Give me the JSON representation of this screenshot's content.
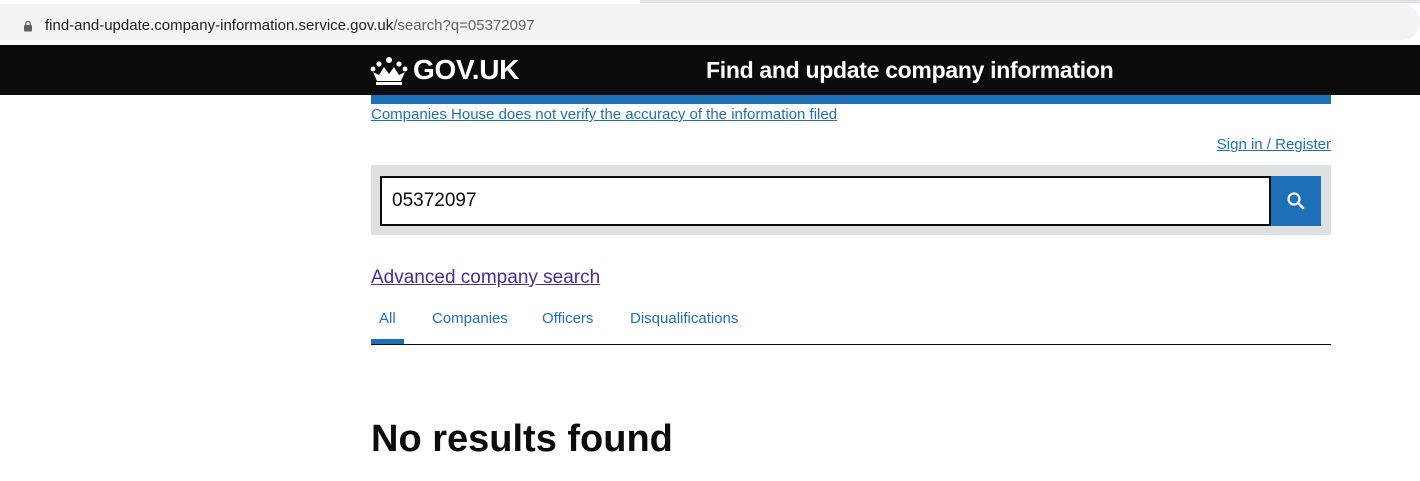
{
  "browser": {
    "url_host": "find-and-update.company-information.service.gov.uk",
    "url_path": "/search?q=05372097"
  },
  "header": {
    "logo_text": "GOV.UK",
    "service_name": "Find and update company information"
  },
  "banner": {
    "disclaimer": "Companies House does not verify the accuracy of the information filed"
  },
  "account": {
    "signin_label": "Sign in / Register"
  },
  "search": {
    "value": "05372097",
    "button_icon": "search-icon"
  },
  "advanced_search": {
    "label": "Advanced company search"
  },
  "tabs": [
    {
      "label": "All",
      "active": true
    },
    {
      "label": "Companies",
      "active": false
    },
    {
      "label": "Officers",
      "active": false
    },
    {
      "label": "Disqualifications",
      "active": false
    }
  ],
  "results": {
    "heading": "No results found"
  },
  "colors": {
    "header_bg": "#0b0c0c",
    "link_blue": "#1d70b8",
    "visited_purple": "#4c2c92",
    "search_panel": "#dee0e2"
  }
}
